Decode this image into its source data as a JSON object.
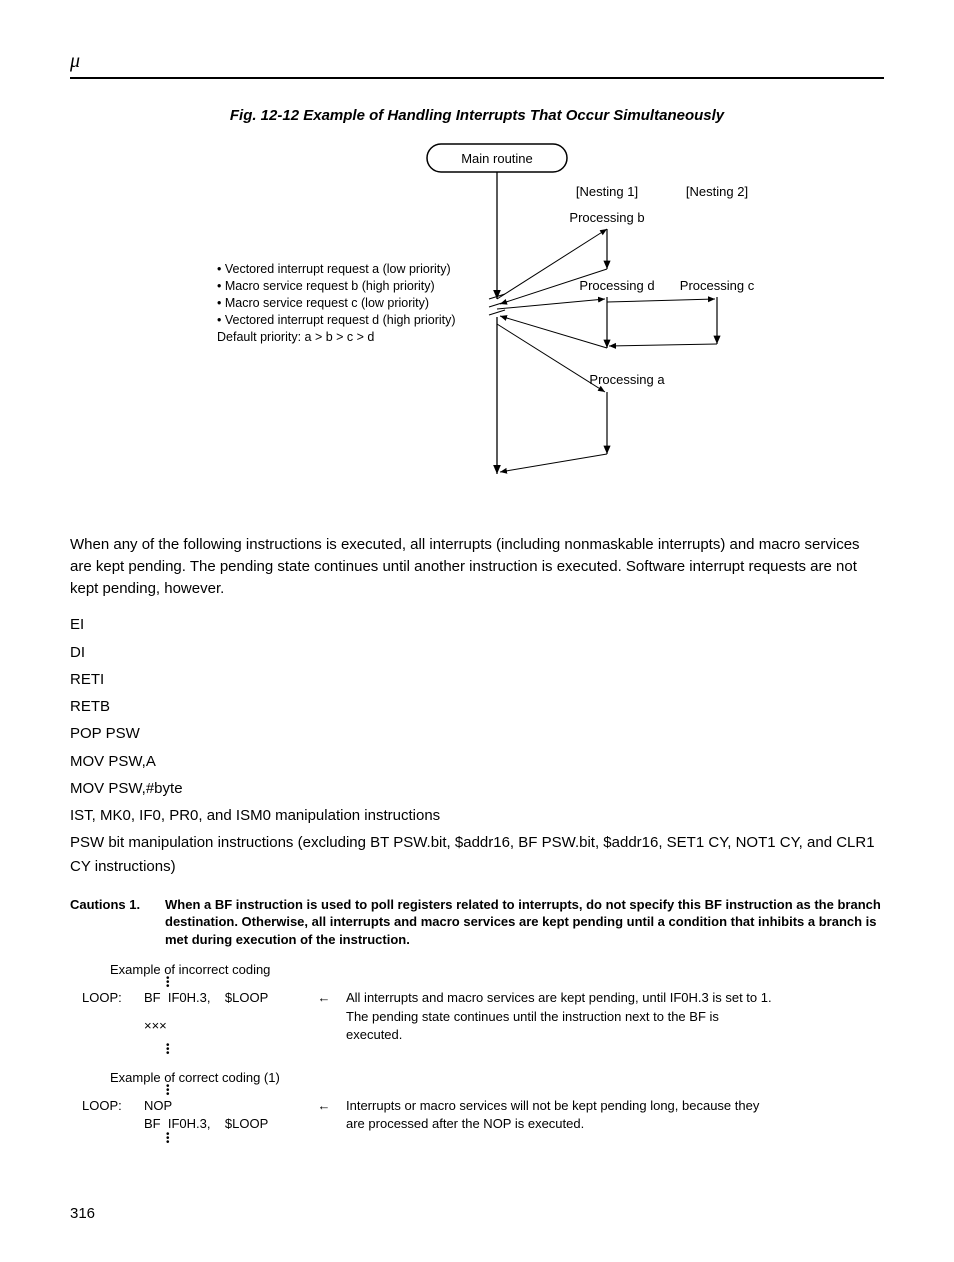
{
  "header_glyph": "μ",
  "figure": {
    "caption": "Fig. 12-12  Example of Handling Interrupts That Occur Simultaneously",
    "main_routine": "Main routine",
    "nesting1": "[Nesting 1]",
    "nesting2": "[Nesting 2]",
    "proc_b": "Processing b",
    "proc_d": "Processing d",
    "proc_c": "Processing c",
    "proc_a": "Processing a",
    "bullets": [
      "• Vectored interrupt request a (low priority)",
      "• Macro service request b (high priority)",
      "• Macro service request c (low priority)",
      "• Vectored interrupt request d (high priority)"
    ],
    "default_priority": "Default priority:  a > b > c > d"
  },
  "paragraph": "When any of the following instructions is executed, all interrupts (including nonmaskable interrupts) and macro services are kept pending.  The pending state continues until another instruction is executed.  Software interrupt requests are not kept pending, however.",
  "instr_list": [
    "EI",
    "DI",
    "RETI",
    "RETB",
    "POP PSW",
    "MOV PSW,A",
    "MOV PSW,#byte",
    "IST, MK0, IF0, PR0, and ISM0 manipulation instructions",
    "PSW bit manipulation instructions (excluding BT PSW.bit, $addr16, BF PSW.bit, $addr16, SET1 CY, NOT1 CY, and CLR1 CY instructions)"
  ],
  "caution_label": "Cautions 1.",
  "caution_text": "When a BF instruction is used to poll registers related to interrupts, do not specify this BF instruction as the branch destination. Otherwise, all interrupts and macro services are kept pending until a condition that inhibits a branch is met during execution of the instruction.",
  "example_incorrect_head": "Example of incorrect coding",
  "example_correct_head": "Example of correct coding (1)",
  "loop_label": "LOOP:",
  "code_incorrect_line1": "BF  IF0H.3,    $LOOP",
  "code_incorrect_line2": "×××",
  "code_correct_line1": "NOP",
  "code_correct_line2": "BF  IF0H.3,    $LOOP",
  "arrow_left": "←",
  "desc_incorrect": "All interrupts and macro services are kept pending, until IF0H.3 is set to 1.  The pending state continues until the instruction next to the BF is executed.",
  "desc_correct": "Interrupts or macro services will not be kept pending long, because they are processed after the NOP is executed.",
  "page_number": "316"
}
